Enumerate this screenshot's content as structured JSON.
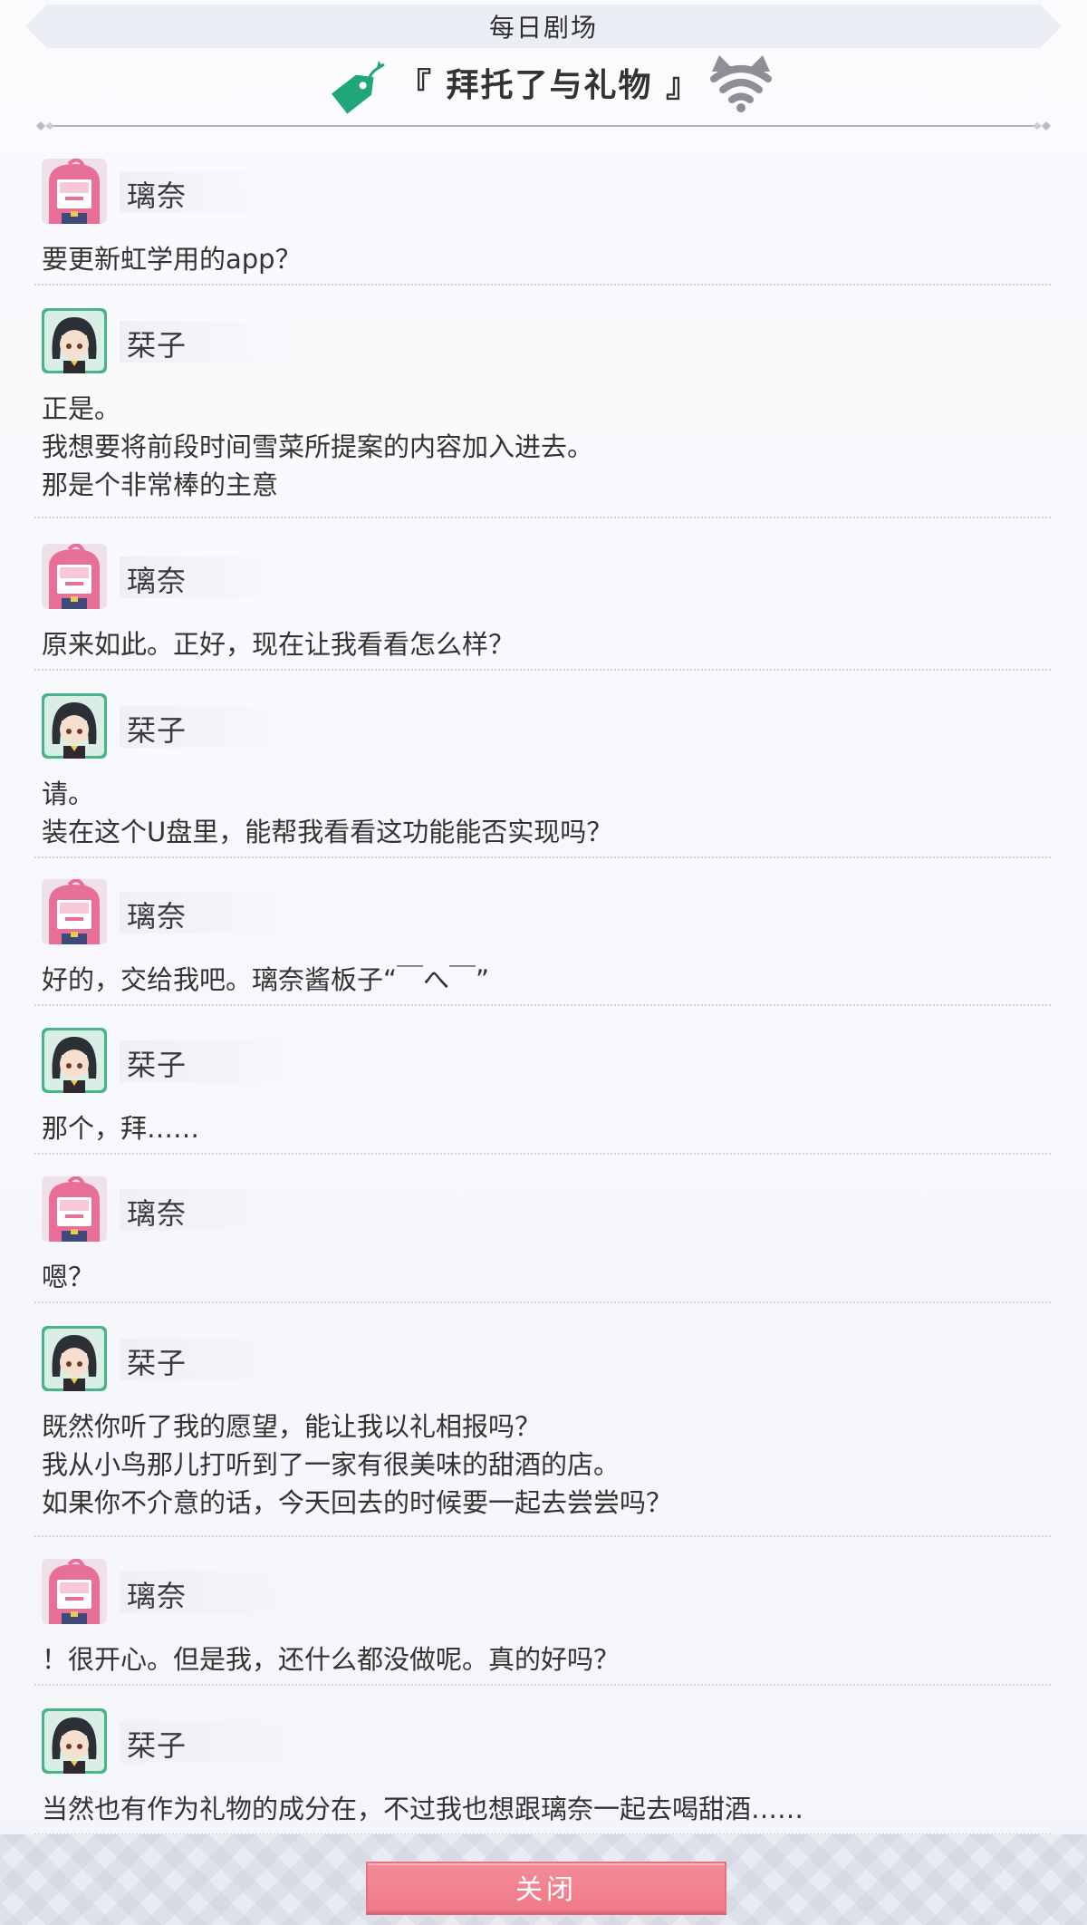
{
  "header": {
    "title": "每日剧场",
    "story_title": "『 拜托了与礼物 』",
    "left_icon": "tag-icon",
    "right_icon": "wifi-cat-icon",
    "accent_color": "#1fa67a"
  },
  "characters": {
    "rina": {
      "name": "璃奈",
      "avatar_icon": "rina-avatar",
      "color": "#e97ea3"
    },
    "shioriko": {
      "name": "栞子",
      "avatar_icon": "shioriko-avatar",
      "color": "#4fbf8e"
    }
  },
  "messages": [
    {
      "speaker": "璃奈",
      "lines": [
        "要更新虹学用的app？"
      ]
    },
    {
      "speaker": "栞子",
      "lines": [
        "正是。",
        "我想要将前段时间雪菜所提案的内容加入进去。",
        "那是个非常棒的主意"
      ]
    },
    {
      "speaker": "璃奈",
      "lines": [
        "原来如此。正好，现在让我看看怎么样？"
      ]
    },
    {
      "speaker": "栞子",
      "lines": [
        "请。",
        "装在这个U盘里，能帮我看看这功能能否实现吗？"
      ]
    },
    {
      "speaker": "璃奈",
      "lines": [
        "好的，交给我吧。璃奈酱板子“￣へ￣”"
      ]
    },
    {
      "speaker": "栞子",
      "lines": [
        "那个，拜……"
      ]
    },
    {
      "speaker": "璃奈",
      "lines": [
        "嗯？"
      ]
    },
    {
      "speaker": "栞子",
      "lines": [
        "既然你听了我的愿望，能让我以礼相报吗？",
        "我从小鸟那儿打听到了一家有很美味的甜酒的店。",
        "如果你不介意的话，今天回去的时候要一起去尝尝吗？"
      ]
    },
    {
      "speaker": "璃奈",
      "lines": [
        "！很开心。但是我，还什么都没做呢。真的好吗？"
      ]
    },
    {
      "speaker": "栞子",
      "lines": [
        "当然也有作为礼物的成分在，不过我也想跟璃奈一起去喝甜酒……"
      ]
    }
  ],
  "footer": {
    "close_label": "关闭",
    "button_color": "#f0808e"
  }
}
